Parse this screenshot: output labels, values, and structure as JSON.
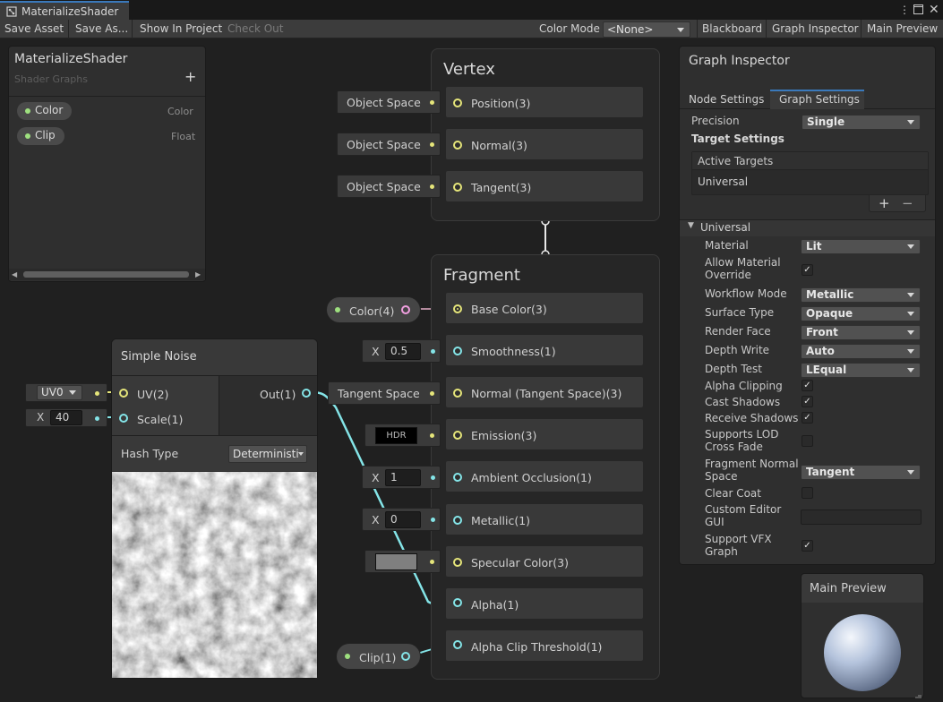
{
  "window": {
    "tab_title": "MaterializeShader"
  },
  "toolbar": {
    "save_asset": "Save Asset",
    "save_as": "Save As...",
    "show_in_project": "Show In Project",
    "check_out": "Check Out",
    "color_mode_label": "Color Mode",
    "color_mode_value": "<None>",
    "blackboard": "Blackboard",
    "graph_inspector": "Graph Inspector",
    "main_preview": "Main Preview"
  },
  "blackboard": {
    "title": "MaterializeShader",
    "subtitle": "Shader Graphs",
    "add": "+",
    "properties": [
      {
        "name": "Color",
        "type": "Color"
      },
      {
        "name": "Clip",
        "type": "Float"
      }
    ]
  },
  "vertex": {
    "title": "Vertex",
    "blocks": [
      {
        "label": "Position(3)",
        "input": "Object Space"
      },
      {
        "label": "Normal(3)",
        "input": "Object Space"
      },
      {
        "label": "Tangent(3)",
        "input": "Object Space"
      }
    ]
  },
  "fragment": {
    "title": "Fragment",
    "blocks": [
      {
        "label": "Base Color(3)"
      },
      {
        "label": "Smoothness(1)"
      },
      {
        "label": "Normal (Tangent Space)(3)"
      },
      {
        "label": "Emission(3)"
      },
      {
        "label": "Ambient Occlusion(1)"
      },
      {
        "label": "Metallic(1)"
      },
      {
        "label": "Specular Color(3)"
      },
      {
        "label": "Alpha(1)"
      },
      {
        "label": "Alpha Clip Threshold(1)"
      }
    ],
    "inputs": {
      "color_node": "Color(4)",
      "smoothness_x": "X",
      "smoothness_value": "0.5",
      "normal_space": "Tangent Space",
      "emission": "HDR",
      "ao_x": "X",
      "ao_value": "1",
      "metallic_x": "X",
      "metallic_value": "0",
      "clip_node": "Clip(1)"
    }
  },
  "simple_noise": {
    "title": "Simple Noise",
    "uv_label": "UV(2)",
    "scale_label": "Scale(1)",
    "out_label": "Out(1)",
    "uv_value": "UV0",
    "scale_x": "X",
    "scale_value": "40",
    "hash_type_label": "Hash Type",
    "hash_type_value": "Deterministi"
  },
  "inspector": {
    "title": "Graph Inspector",
    "tabs": [
      "Node Settings",
      "Graph Settings"
    ],
    "precision_label": "Precision",
    "precision_value": "Single",
    "target_settings": "Target Settings",
    "active_targets": "Active Targets",
    "target": "Universal",
    "plus": "+",
    "minus": "−",
    "section": "Universal",
    "properties": [
      {
        "label": "Material",
        "kind": "dropdown",
        "value": "Lit"
      },
      {
        "label": "Allow Material Override",
        "kind": "check",
        "checked": true
      },
      {
        "label": "Workflow Mode",
        "kind": "dropdown",
        "value": "Metallic"
      },
      {
        "label": "Surface Type",
        "kind": "dropdown",
        "value": "Opaque"
      },
      {
        "label": "Render Face",
        "kind": "dropdown",
        "value": "Front"
      },
      {
        "label": "Depth Write",
        "kind": "dropdown",
        "value": "Auto"
      },
      {
        "label": "Depth Test",
        "kind": "dropdown",
        "value": "LEqual"
      },
      {
        "label": "Alpha Clipping",
        "kind": "check",
        "checked": true
      },
      {
        "label": "Cast Shadows",
        "kind": "check",
        "checked": true
      },
      {
        "label": "Receive Shadows",
        "kind": "check",
        "checked": true
      },
      {
        "label": "Supports LOD Cross Fade",
        "kind": "check",
        "checked": false
      },
      {
        "label": "Fragment Normal Space",
        "kind": "dropdown",
        "value": "Tangent"
      },
      {
        "label": "Clear Coat",
        "kind": "check",
        "checked": false
      },
      {
        "label": "Custom Editor GUI",
        "kind": "text",
        "value": ""
      },
      {
        "label": "Support VFX Graph",
        "kind": "check",
        "checked": true
      }
    ]
  },
  "main_preview": {
    "title": "Main Preview"
  },
  "colors": {
    "vector_port": "#e5e57a",
    "float_port": "#84e4e7",
    "color_port": "#f19fe0",
    "property_dot": "#9ee07f",
    "tab_accent": "#3a79bb"
  }
}
